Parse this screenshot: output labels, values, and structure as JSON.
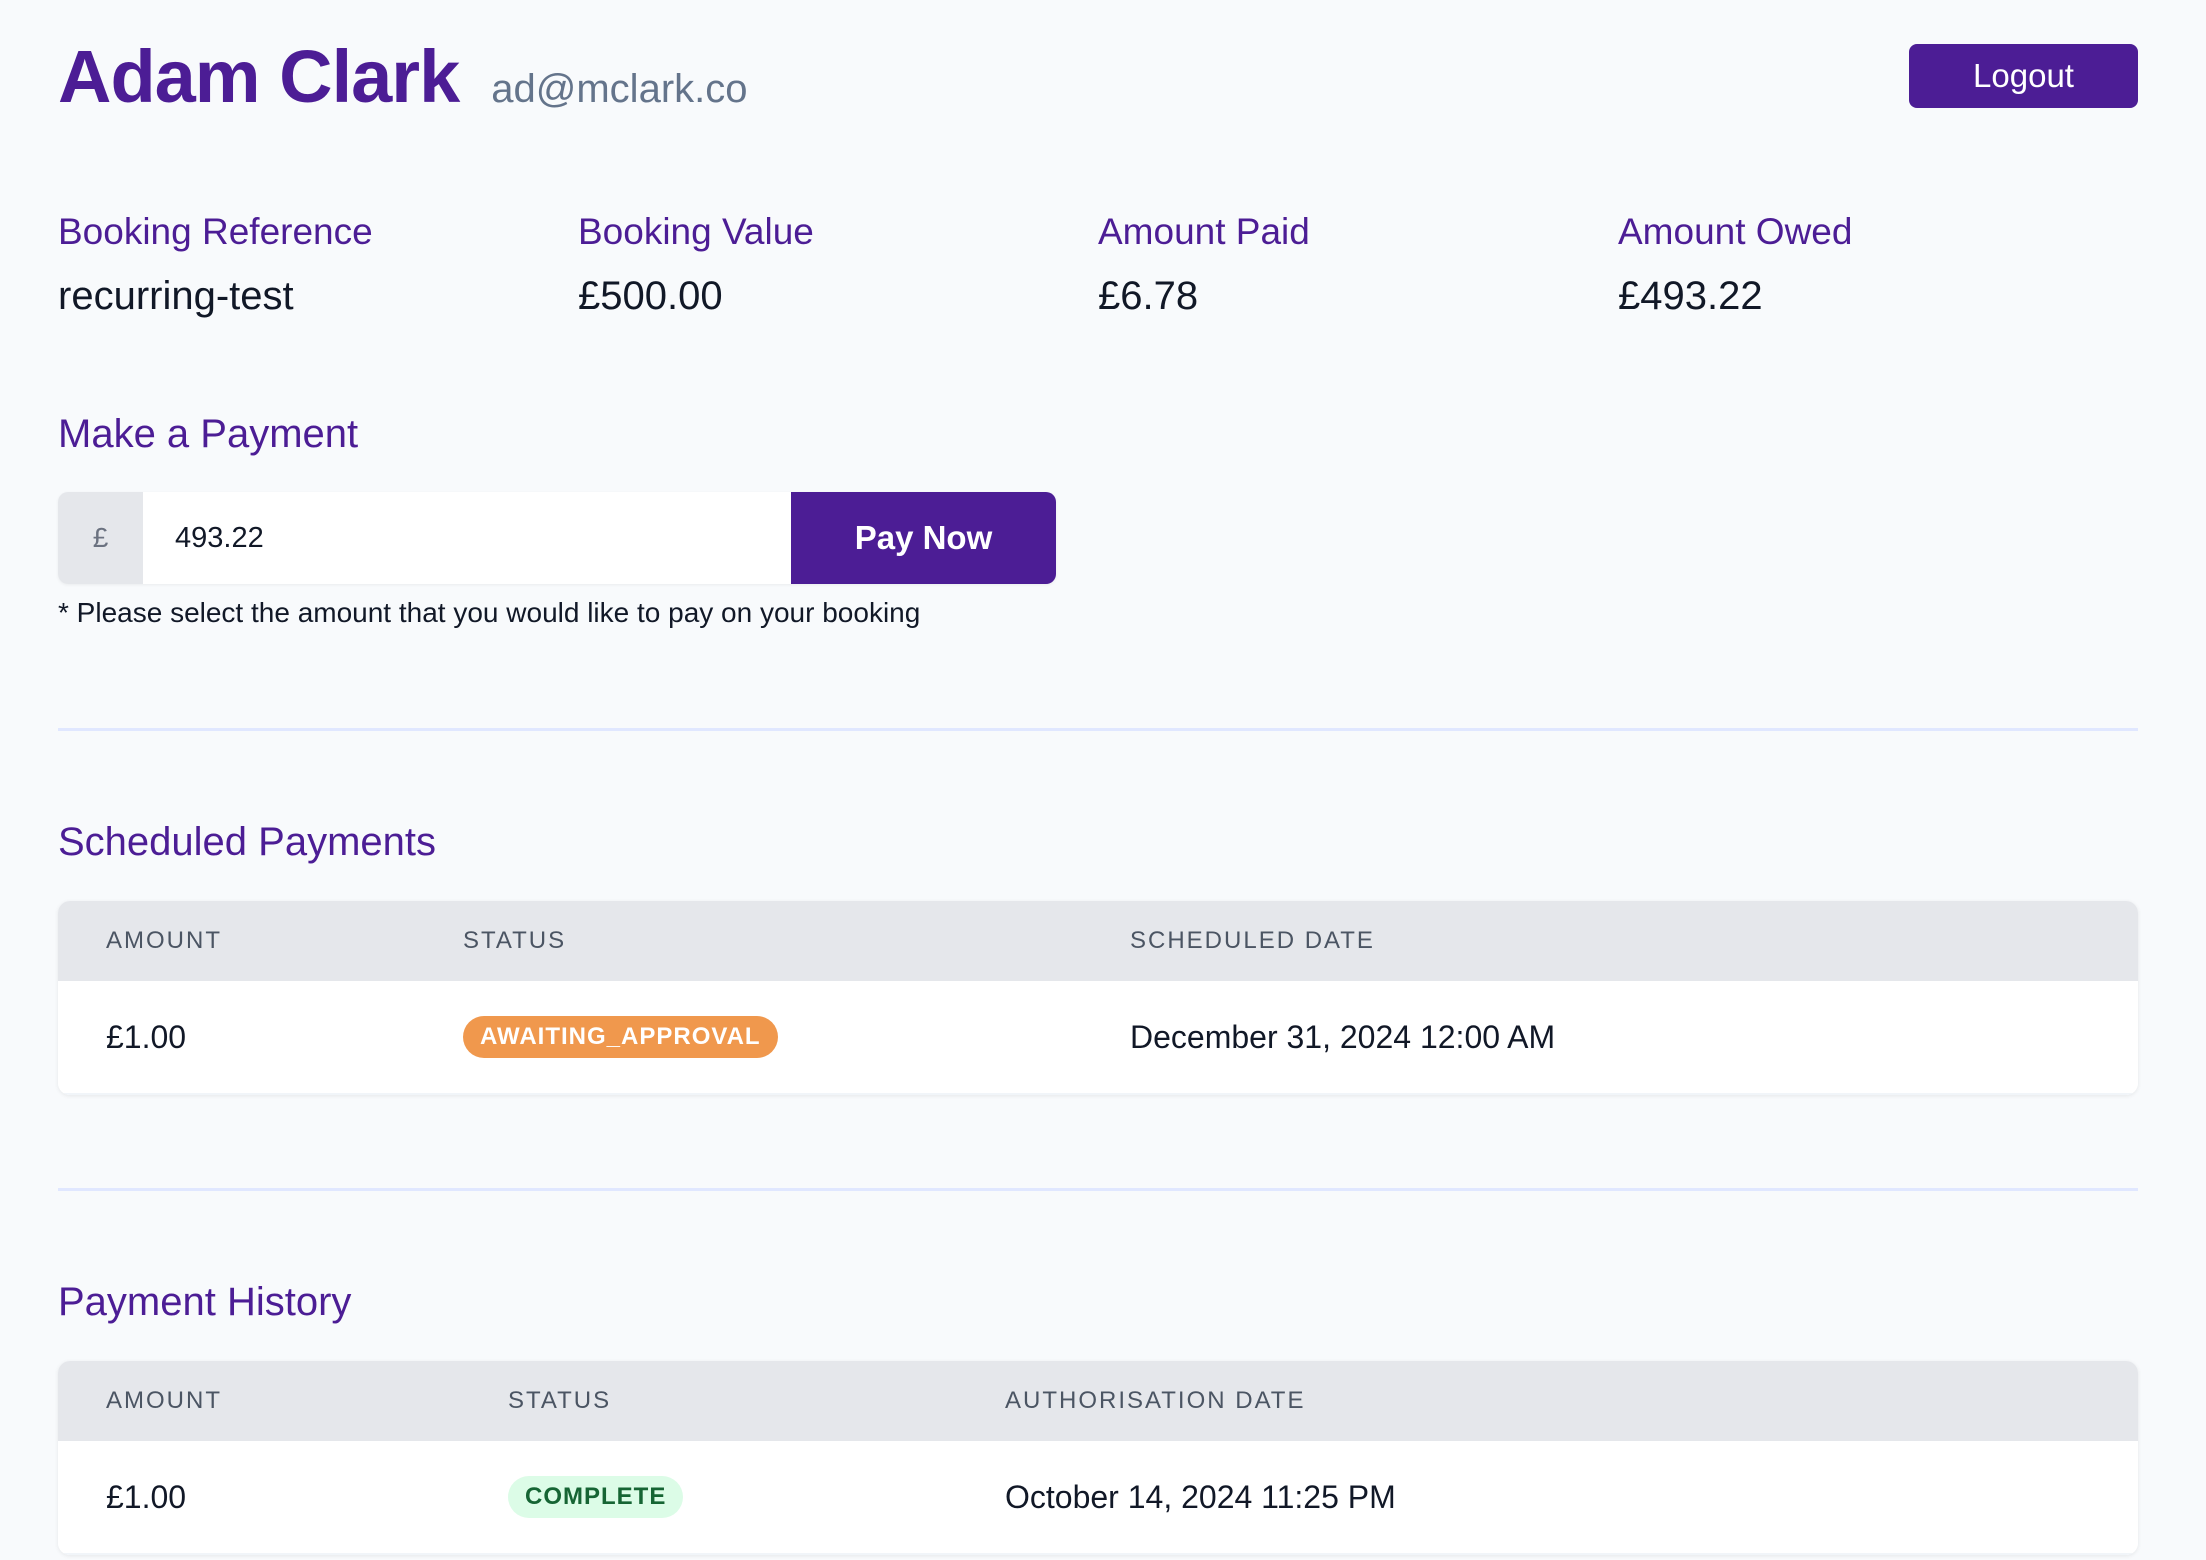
{
  "header": {
    "user_name": "Adam Clark",
    "user_email": "ad@mclark.co",
    "logout_label": "Logout"
  },
  "stats": [
    {
      "label": "Booking Reference",
      "value": "recurring-test"
    },
    {
      "label": "Booking Value",
      "value": "£500.00"
    },
    {
      "label": "Amount Paid",
      "value": "£6.78"
    },
    {
      "label": "Amount Owed",
      "value": "£493.22"
    }
  ],
  "payment": {
    "title": "Make a Payment",
    "currency_symbol": "£",
    "amount_value": "493.22",
    "pay_label": "Pay Now",
    "hint": "* Please select the amount that you would like to pay on your booking"
  },
  "scheduled": {
    "title": "Scheduled Payments",
    "columns": [
      "AMOUNT",
      "STATUS",
      "SCHEDULED DATE"
    ],
    "rows": [
      {
        "amount": "£1.00",
        "status": "AWAITING_APPROVAL",
        "date": "December 31, 2024 12:00 AM"
      }
    ]
  },
  "history": {
    "title": "Payment History",
    "columns": [
      "AMOUNT",
      "STATUS",
      "AUTHORISATION DATE"
    ],
    "rows": [
      {
        "amount": "£1.00",
        "status": "COMPLETE",
        "date": "October 14, 2024 11:25 PM"
      }
    ]
  },
  "colors": {
    "brand": "#4c1d95",
    "awaiting_badge": "#f0984d",
    "complete_badge_bg": "#dcfce7",
    "complete_badge_text": "#166534"
  }
}
